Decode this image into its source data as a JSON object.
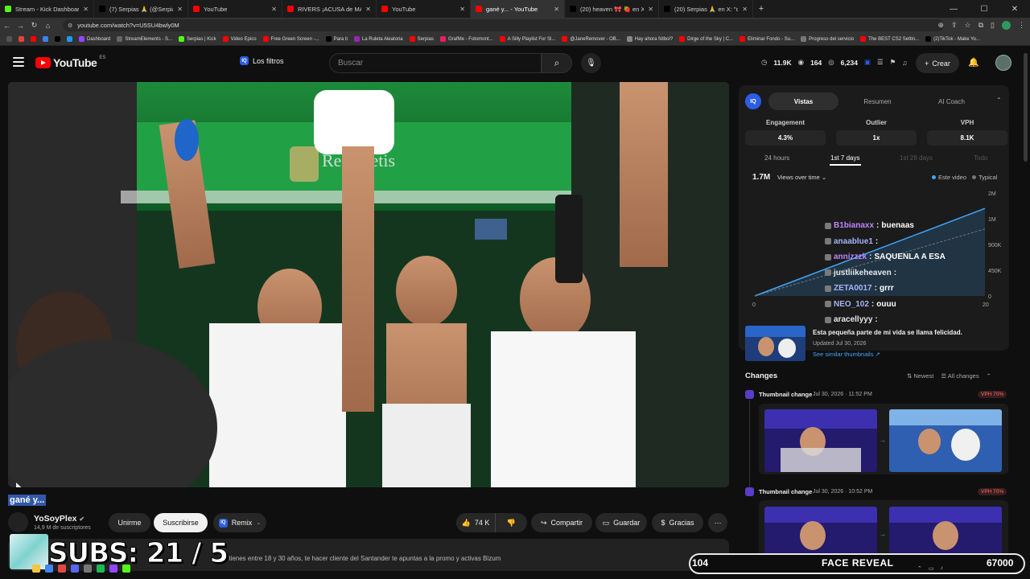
{
  "browser": {
    "tabs": [
      {
        "label": "Stream - Kick Dashboard",
        "color": "#53fc18",
        "active": false
      },
      {
        "label": "(7) Serpias 🙏 (@Serpias) / X",
        "color": "#000000",
        "active": false
      },
      {
        "label": "YouTube",
        "color": "#ff0000",
        "active": false
      },
      {
        "label": "RIVERS ¡ACUSA de MANIPULAR...",
        "color": "#ff0000",
        "active": false
      },
      {
        "label": "YouTube",
        "color": "#ff0000",
        "active": false
      },
      {
        "label": "gané y... - YouTube",
        "color": "#ff0000",
        "active": true
      },
      {
        "label": "(20) heaven 🎀 🍓 en X: \"los lin...",
        "color": "#000000",
        "active": false
      },
      {
        "label": "(20) Serpias 🙏 en X: \"como la...",
        "color": "#000000",
        "active": false
      }
    ],
    "url": "youtube.com/watch?v=U5SU4bwly0M",
    "bookmarks": [
      {
        "label": "",
        "color": "#555555"
      },
      {
        "label": "",
        "color": "#ea4335"
      },
      {
        "label": "",
        "color": "#ff0000"
      },
      {
        "label": "",
        "color": "#3b82f6"
      },
      {
        "label": "",
        "color": "#000000"
      },
      {
        "label": "",
        "color": "#1d9bf0"
      },
      {
        "label": "Dashboard",
        "color": "#9147ff"
      },
      {
        "label": "StreamElements - S...",
        "color": "#666666"
      },
      {
        "label": "Serpias | Kick",
        "color": "#53fc18"
      },
      {
        "label": "Video Epico",
        "color": "#ff0000"
      },
      {
        "label": "Free Green Screen -...",
        "color": "#ff0000"
      },
      {
        "label": "Para ti",
        "color": "#000000"
      },
      {
        "label": "La Ruleta Aleatoria",
        "color": "#9c27b0"
      },
      {
        "label": "Serpias",
        "color": "#ff0000"
      },
      {
        "label": "GrafMe - Fotomont...",
        "color": "#e91e63"
      },
      {
        "label": "A Silly Playlist For Sl...",
        "color": "#ff0000"
      },
      {
        "label": "@JaneRemover - OB...",
        "color": "#ff0000"
      },
      {
        "label": "Hay ahora fútbol?",
        "color": "#888888"
      },
      {
        "label": "Dirge of the Sky | C...",
        "color": "#ff0000"
      },
      {
        "label": "Eliminar Fondo - Su...",
        "color": "#ff0000"
      },
      {
        "label": "Progreso del servicio",
        "color": "#777777"
      },
      {
        "label": "The BEST CS2 Settin...",
        "color": "#ff0000"
      },
      {
        "label": "(2)TikTok - Make Yo...",
        "color": "#000000"
      }
    ]
  },
  "header": {
    "logo": "YouTube",
    "country": "ES",
    "filters_label": "Los filtros",
    "search_placeholder": "Buscar",
    "stats": {
      "a": "11.9K",
      "b": "164",
      "c": "6,234"
    },
    "create_label": "Crear"
  },
  "video": {
    "title": "gané y...",
    "channel": "YoSoyPlex",
    "subscribers": "14,9 M de suscriptores",
    "join_label": "Unirme",
    "subscribe_label": "Suscribirse",
    "remix_label": "Remix",
    "likes": "74 K",
    "share_label": "Compartir",
    "save_label": "Guardar",
    "thanks_label": "Gracias",
    "description_snippet": "Si tienes entre 18 y 30 años, te hacer cliente del Santander te apuntas a la promo y activas Bizum"
  },
  "panel": {
    "iq": "IQ",
    "tabs": [
      "Vistas",
      "Resumen",
      "AI Coach"
    ],
    "metrics": [
      {
        "label": "Engagement",
        "value": "4.3%"
      },
      {
        "label": "Outlier",
        "value": "1x"
      },
      {
        "label": "VPH",
        "value": "8.1K"
      }
    ],
    "ranges": [
      "24 hours",
      "1st 7 days",
      "1st 28 days",
      "Todo"
    ],
    "views_total": "1.7M",
    "views_dropdown": "Views over time",
    "legend": [
      {
        "label": "Este video",
        "color": "#3ea6ff"
      },
      {
        "label": "Typical",
        "color": "#777777"
      }
    ],
    "thumb_title": "Esta pequeña parte de mi vida se llama felicidad.",
    "thumb_updated": "Updated Jul 30, 2026",
    "thumb_similar": "See similar thumbnails",
    "changes_title": "Changes",
    "changes_sort": "Newest",
    "changes_filter": "All changes",
    "changes": [
      {
        "title": "Thumbnail change",
        "date": "Jul 30, 2026 · 11:52 PM",
        "badge": "VPH 70%"
      },
      {
        "title": "Thumbnail change",
        "date": "Jul 30, 2026 · 10:52 PM",
        "badge": "VPH 70%"
      }
    ]
  },
  "chart_data": {
    "type": "line",
    "x": [
      0,
      20
    ],
    "series": [
      {
        "name": "Este video",
        "values": [
          0,
          1700000
        ]
      },
      {
        "name": "Typical",
        "values": [
          0,
          1300000
        ]
      }
    ],
    "yticks": [
      "2M",
      "1M",
      "900K",
      "450K",
      "0"
    ],
    "xticks": [
      "0",
      "20"
    ],
    "title": "",
    "xlabel": "",
    "ylabel": ""
  },
  "chat": [
    {
      "user": "B1bianaxx",
      "msg": "buenaas",
      "color": "#c084fc"
    },
    {
      "user": "anaablue1",
      "msg": "",
      "color": "#a5b4fc"
    },
    {
      "user": "annizzzk",
      "msg": "SAQUENLA A ESA",
      "color": "#c084fc"
    },
    {
      "user": "justliikeheaven",
      "msg": "",
      "color": "#e5e7eb"
    },
    {
      "user": "ZETA0017",
      "msg": "grrr",
      "color": "#a5b4fc"
    },
    {
      "user": "NEO_102",
      "msg": "ouuu",
      "color": "#a5b4fc"
    },
    {
      "user": "aracellyyy",
      "msg": "",
      "color": "#e5e7eb"
    }
  ],
  "overlay": {
    "subs": "SUBS: 21 / 5",
    "bar_left": "104",
    "bar_mid": "FACE REVEAL",
    "bar_right": "67000"
  },
  "colors": {
    "accent": "#3ea6ff",
    "brand": "#ff0000",
    "iq": "#2b5de6"
  }
}
